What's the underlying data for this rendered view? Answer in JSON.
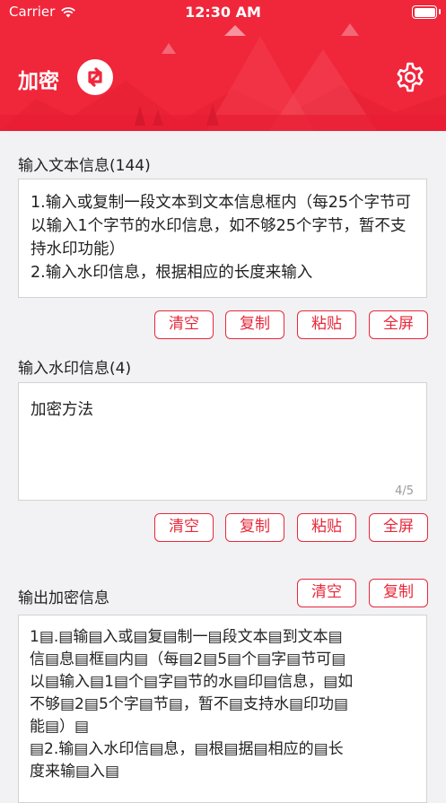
{
  "status_bar": {
    "carrier": "Carrier",
    "time": "12:30 AM"
  },
  "header": {
    "title": "加密"
  },
  "text_input": {
    "label": "输入文本信息(144)",
    "value": "1.输入或复制一段文本到文本信息框内（每25个字节可以输入1个字节的水印信息，如不够25个字节，暂不支持水印功能）\n2.输入水印信息，根据相应的长度来输入"
  },
  "text_buttons": {
    "clear": "清空",
    "copy": "复制",
    "paste": "粘贴",
    "fullscreen": "全屏"
  },
  "watermark_input": {
    "label": "输入水印信息(4)",
    "value": "加密方法",
    "counter": "4/5"
  },
  "watermark_buttons": {
    "clear": "清空",
    "copy": "复制",
    "paste": "粘贴",
    "fullscreen": "全屏"
  },
  "output": {
    "label": "输出加密信息",
    "clear": "清空",
    "copy": "复制",
    "value": "1▤.▤输▤入或▤复▤制一▤段文本▤到文本▤\n信▤息▤框▤内▤（每▤2▤5▤个▤字▤节可▤\n以▤输入▤1▤个▤字▤节的水▤印▤信息，▤如\n不够▤2▤5个字▤节▤，暂不▤支持水▤印功▤\n能▤）▤\n▤2.输▤入水印信▤息，▤根▤据▤相应的▤长\n度来输▤入▤"
  },
  "colors": {
    "accent": "#f0263b",
    "button": "#e8283a"
  },
  "icons": {
    "swap": "swap-arrows-icon",
    "settings": "gear-icon",
    "wifi": "wifi-icon",
    "battery": "battery-icon"
  }
}
